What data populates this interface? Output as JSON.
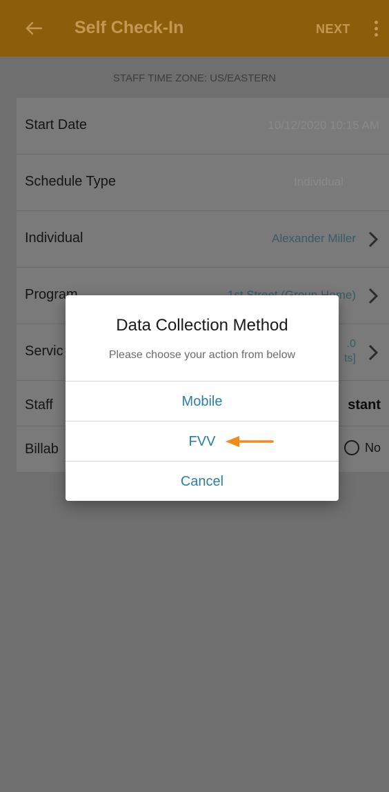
{
  "appbar": {
    "title": "Self Check-In",
    "next_label": "NEXT",
    "back_icon": "arrow-left-icon",
    "more_icon": "more-vertical-icon"
  },
  "timezone": "STAFF TIME ZONE: US/EASTERN",
  "form": {
    "start_date": {
      "label": "Start Date",
      "value": "10/12/2020 10:15 AM"
    },
    "schedule_type": {
      "label": "Schedule Type",
      "value": "Individual"
    },
    "individual": {
      "label": "Individual",
      "value": "Alexander Miller"
    },
    "program": {
      "label": "Program",
      "value": "1st Street (Group Home)"
    },
    "service": {
      "label": "Servic",
      "value_line1": ".0",
      "value_line2": "ts]"
    },
    "staff": {
      "label": "Staff",
      "value": "stant"
    },
    "billable": {
      "label": "Billab",
      "option_no": "No"
    }
  },
  "dialog": {
    "title": "Data Collection Method",
    "subtitle": "Please choose your action from below",
    "options": [
      "Mobile",
      "FVV",
      "Cancel"
    ],
    "annotation": "orange-arrow-icon"
  },
  "colors": {
    "appbar": "#8c5d0b",
    "accent_text": "#c49853",
    "dialog_option": "#2a7fa8",
    "arrow": "#f28a1c"
  }
}
